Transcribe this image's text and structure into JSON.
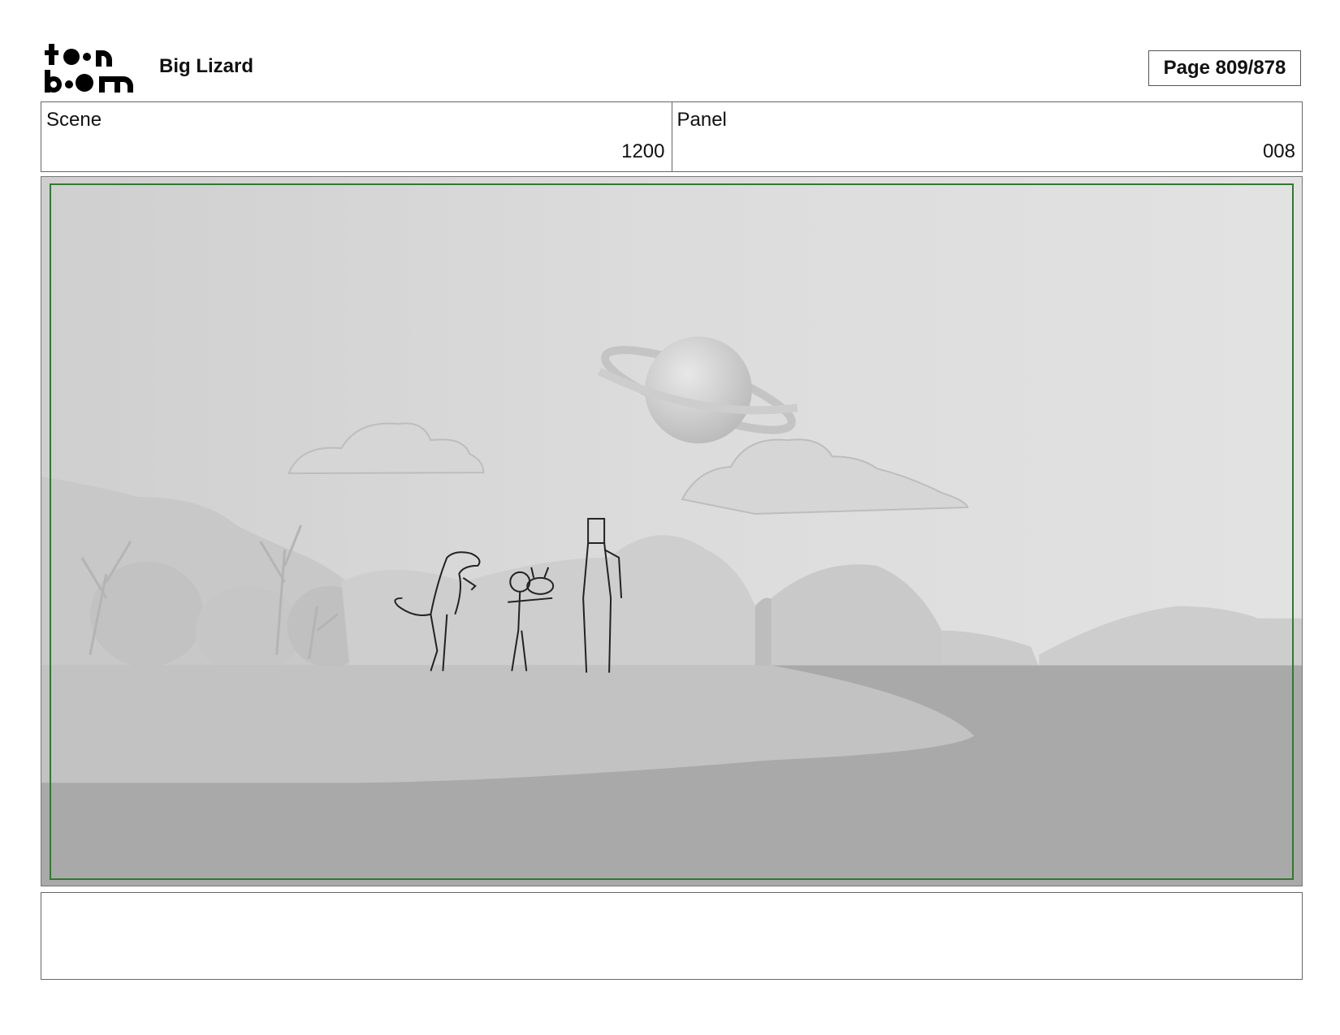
{
  "header": {
    "logo_text": [
      "to•n",
      "b••m"
    ],
    "project_title": "Big Lizard",
    "page_label": "Page 809/878"
  },
  "info": {
    "scene_label": "Scene",
    "scene_value": "1200",
    "panel_label": "Panel",
    "panel_value": "008"
  },
  "colors": {
    "safe_frame": "#2f7a2f",
    "panel_background": "#e4e4e4"
  },
  "notes": ""
}
